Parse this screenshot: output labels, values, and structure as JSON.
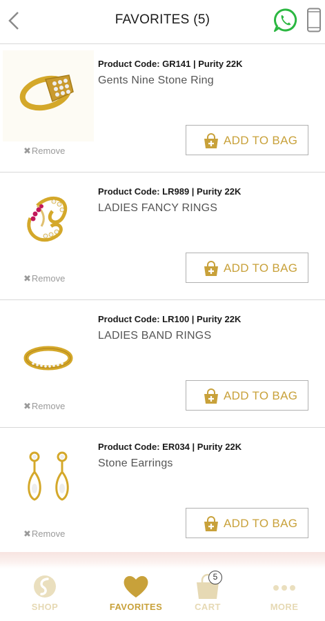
{
  "header": {
    "title": "FAVORITES (5)"
  },
  "products": [
    {
      "code_line": "Product Code: GR141 | Purity 22K",
      "name": "Gents Nine Stone Ring",
      "remove_label": "Remove",
      "add_label": "ADD TO BAG"
    },
    {
      "code_line": "Product Code: LR989 | Purity 22K",
      "name": "LADIES FANCY RINGS",
      "remove_label": "Remove",
      "add_label": "ADD TO BAG"
    },
    {
      "code_line": "Product Code: LR100 | Purity 22K",
      "name": "LADIES BAND RINGS",
      "remove_label": "Remove",
      "add_label": "ADD TO BAG"
    },
    {
      "code_line": "Product Code: ER034 | Purity 22K",
      "name": "Stone Earrings",
      "remove_label": "Remove",
      "add_label": "ADD TO BAG"
    }
  ],
  "tabbar": {
    "tabs": [
      {
        "label": "SHOP",
        "icon": "shop-icon"
      },
      {
        "label": "FAVORITES",
        "icon": "heart-icon"
      },
      {
        "label": "CART",
        "icon": "cart-icon",
        "badge": "5"
      },
      {
        "label": "MORE",
        "icon": "more-dots-icon"
      }
    ]
  },
  "colors": {
    "accent_gold": "#c8a13a",
    "faded_gold": "#e6d9b4",
    "whatsapp_green": "#2bb741"
  }
}
